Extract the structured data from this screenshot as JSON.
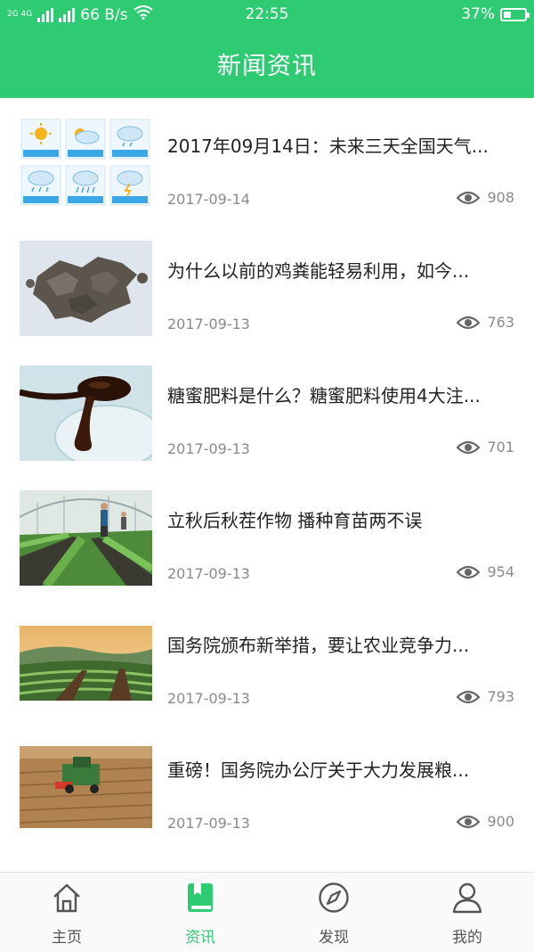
{
  "status_bar": {
    "signal": "2G 4G",
    "net_speed": "66 B/s",
    "time": "22:55",
    "battery": "37%",
    "battery_level": 0.37
  },
  "header": {
    "title": "新闻资讯"
  },
  "accent_color": "#2ecb73",
  "news": [
    {
      "title": "2017年09月14日：未来三天全国天气...",
      "date": "2017-09-14",
      "views": "908",
      "thumb": "weather-icons"
    },
    {
      "title": "为什么以前的鸡粪能轻易利用，如今...",
      "date": "2017-09-13",
      "views": "763",
      "thumb": "chicken-manure"
    },
    {
      "title": "糖蜜肥料是什么？糖蜜肥料使用4大注...",
      "date": "2017-09-13",
      "views": "701",
      "thumb": "molasses-spoon"
    },
    {
      "title": "立秋后秋茬作物 播种育苗两不误",
      "date": "2017-09-13",
      "views": "954",
      "thumb": "greenhouse"
    },
    {
      "title": "国务院颁布新举措，要让农业竞争力...",
      "date": "2017-09-13",
      "views": "793",
      "thumb": "terraced-fields"
    },
    {
      "title": "重磅！国务院办公厅关于大力发展粮...",
      "date": "2017-09-13",
      "views": "900",
      "thumb": "harvester"
    }
  ],
  "tabs": [
    {
      "label": "主页",
      "icon": "home-icon",
      "active": false
    },
    {
      "label": "资讯",
      "icon": "book-icon",
      "active": true
    },
    {
      "label": "发现",
      "icon": "compass-icon",
      "active": false
    },
    {
      "label": "我的",
      "icon": "user-icon",
      "active": false
    }
  ]
}
